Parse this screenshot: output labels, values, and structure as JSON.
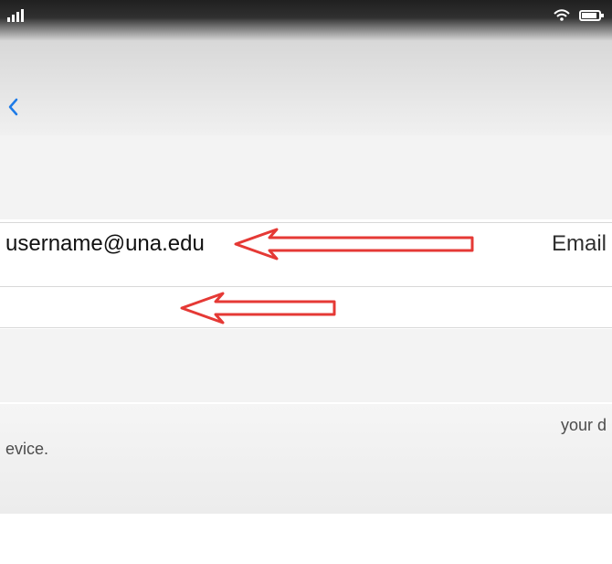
{
  "status_bar": {
    "left": "",
    "right": ""
  },
  "nav": {
    "back_label": "",
    "title": "",
    "next_label": ""
  },
  "fields": {
    "email_value": "username@una.edu",
    "email_label": "Email",
    "description_value": "",
    "description_label": ""
  },
  "warning": {
    "text": "",
    "tail": "your d",
    "tail2": "evice."
  },
  "footer": {
    "link_text": ""
  },
  "colors": {
    "accent": "#1e7be7",
    "annotation": "#e53935",
    "background": "#ffffff",
    "band": "#f3f3f3"
  },
  "icons": {
    "back": "chevron-left-icon",
    "signal": "signal-icon",
    "wifi": "wifi-icon",
    "battery": "battery-icon"
  }
}
